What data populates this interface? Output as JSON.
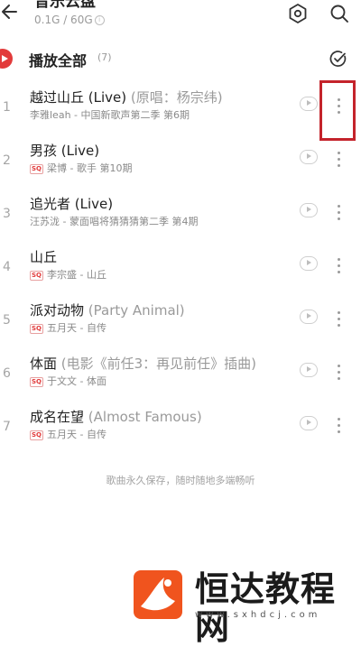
{
  "header": {
    "title": "音乐云盘",
    "storage": "0.1G / 60G",
    "icons": [
      "back-arrow-icon",
      "info-icon",
      "gear-icon",
      "search-icon"
    ]
  },
  "play_all": {
    "label": "播放全部",
    "count": "(7)",
    "icons": [
      "play-icon",
      "multi-select-icon"
    ]
  },
  "songs": [
    {
      "index": "1",
      "title": "越过山丘 (Live)",
      "extra": " (原唱：杨宗纬)",
      "quality": "",
      "subtitle": "李雅leah - 中国新歌声第二季 第6期"
    },
    {
      "index": "2",
      "title": "男孩 (Live)",
      "extra": "",
      "quality": "SQ",
      "subtitle": "梁博 - 歌手 第10期"
    },
    {
      "index": "3",
      "title": "追光者 (Live)",
      "extra": "",
      "quality": "",
      "subtitle": "汪苏泷 - 蒙面唱将猜猜猜第二季 第4期"
    },
    {
      "index": "4",
      "title": "山丘",
      "extra": "",
      "quality": "SQ",
      "subtitle": "李宗盛 - 山丘"
    },
    {
      "index": "5",
      "title": "派对动物",
      "extra": " (Party Animal)",
      "quality": "SQ",
      "subtitle": "五月天 - 自传"
    },
    {
      "index": "6",
      "title": "体面",
      "extra": " (电影《前任3：再见前任》插曲)",
      "quality": "SQ",
      "subtitle": "于文文 - 体面"
    },
    {
      "index": "7",
      "title": "成名在望",
      "extra": " (Almost Famous)",
      "quality": "SQ",
      "subtitle": "五月天 - 自传"
    }
  ],
  "footer_note": "歌曲永久保存，随时随地多端畅听",
  "watermark": {
    "text": "恒达教程网",
    "url": "www.sxhdcj.com"
  },
  "colors": {
    "accent": "#e23b3b",
    "highlight_box": "#c4232b",
    "watermark_logo": "#f0541e"
  }
}
